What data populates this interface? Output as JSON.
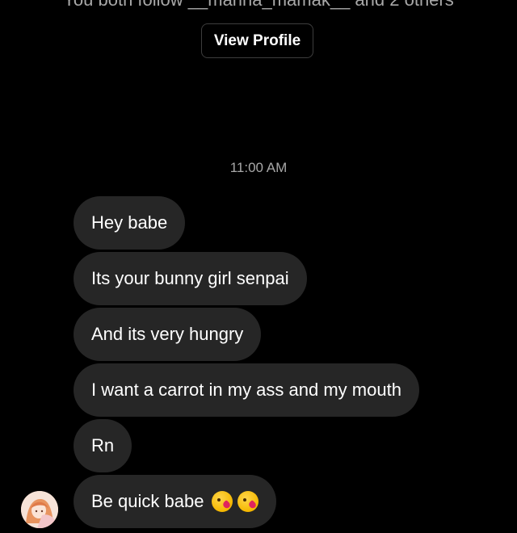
{
  "header": {
    "mutual_followers_text": "You both follow __marina_mamak__ and 2 others",
    "view_profile_label": "View Profile"
  },
  "thread": {
    "timestamp": "11:00 AM",
    "messages": [
      {
        "text": "Hey babe"
      },
      {
        "text": "Its your bunny girl senpai"
      },
      {
        "text": "And its very hungry"
      },
      {
        "text": "I want a carrot in my ass and my mouth"
      },
      {
        "text": "Rn"
      },
      {
        "text": "Be quick babe",
        "emoji": [
          "kissing-heart-icon",
          "kissing-heart-icon"
        ]
      }
    ]
  },
  "colors": {
    "background": "#000000",
    "bubble_received": "#262626",
    "secondary_text": "#a8a8a8",
    "button_border": "#3d3d3d"
  }
}
